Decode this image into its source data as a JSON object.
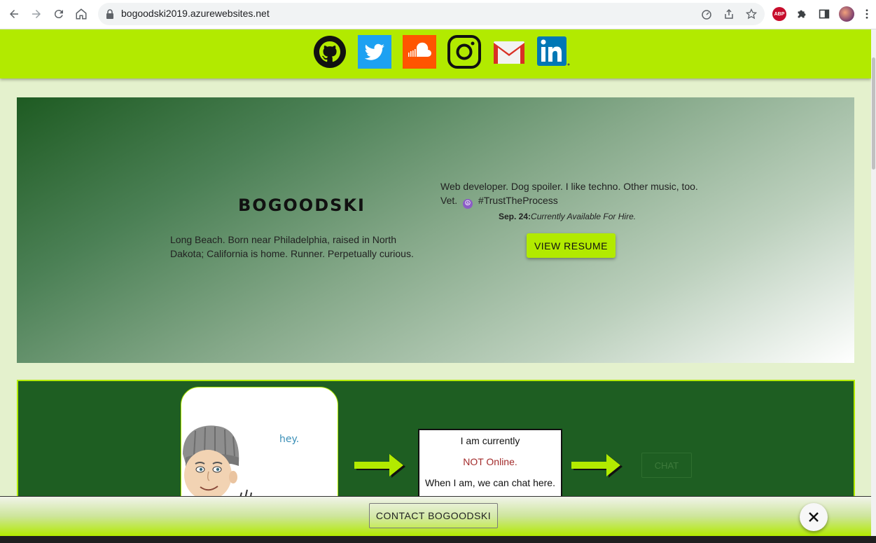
{
  "browser": {
    "url": "bogoodski2019.azurewebsites.net",
    "icons": [
      "back-icon",
      "forward-icon",
      "reload-icon",
      "home-icon",
      "lock-icon",
      "performance-icon",
      "share-icon",
      "bookmark-star-icon",
      "adblock-plus-icon",
      "extensions-puzzle-icon",
      "side-panel-icon",
      "profile-avatar",
      "menu-kebab-icon"
    ],
    "abp_label": "ABP"
  },
  "social_links": [
    {
      "name": "github-icon",
      "color": "#111111"
    },
    {
      "name": "twitter-icon",
      "color": "#1da1f2"
    },
    {
      "name": "soundcloud-icon",
      "color": "#ff5500"
    },
    {
      "name": "instagram-icon",
      "color": "#111111"
    },
    {
      "name": "gmail-icon",
      "color": "#d93025"
    },
    {
      "name": "linkedin-icon",
      "color": "#0077b5"
    }
  ],
  "hero": {
    "brand": "BOGOODSKI",
    "bio": "Long Beach. Born near Philadelphia, raised in North Dakota; California is home. Runner. Perpetually curious.",
    "tagline_before": "Web developer. Dog spoiler. I like techno. Other music, too. Vet.",
    "peace_symbol": "☮",
    "tagline_after": "#TrustTheProcess",
    "status_date": "Sep. 24:",
    "status_text": "Currently Available For Hire.",
    "resume_button": "VIEW RESUME"
  },
  "chat": {
    "bitmoji_text": "hey.",
    "status_line1": "I am currently",
    "status_line2": "NOT Online.",
    "status_line3": "When I am, we can chat here.",
    "chat_button": "CHAT"
  },
  "footer": {
    "contact_button": "CONTACT BOGOODSKI"
  },
  "colors": {
    "accent": "#b2ea00",
    "dark_green": "#1e5e22",
    "offline_red": "#a32b2b"
  }
}
